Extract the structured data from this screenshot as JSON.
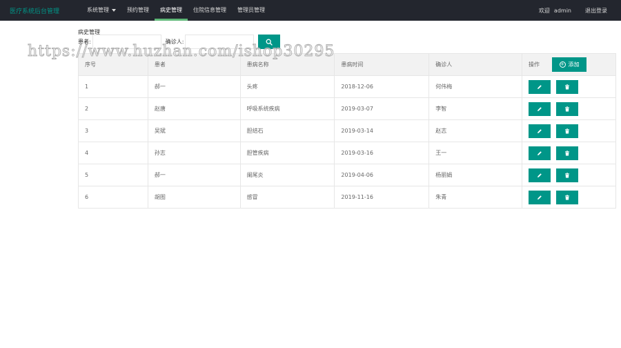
{
  "app": {
    "title": "医疗系统后台管理"
  },
  "nav": {
    "items": [
      {
        "label": "系统管理",
        "has_dropdown": true,
        "active": false
      },
      {
        "label": "预约管理",
        "active": false
      },
      {
        "label": "病史管理",
        "active": true
      },
      {
        "label": "住院信息管理",
        "active": false
      },
      {
        "label": "管理员管理",
        "active": false
      }
    ]
  },
  "user": {
    "welcome": "欢迎",
    "name": "admin",
    "logout": "退出登录"
  },
  "page": {
    "section_title": "病史管理"
  },
  "search": {
    "patient_label": "患者:",
    "patient_value": "",
    "doctor_label": "确诊人:",
    "doctor_value": ""
  },
  "watermark": "https://www.huzhan.com/ishop30295",
  "table": {
    "headers": [
      "序号",
      "患者",
      "患病名称",
      "患病时间",
      "确诊人",
      "操作"
    ],
    "add_label": "添加",
    "rows": [
      [
        "1",
        "郝一",
        "头疼",
        "2018-12-06",
        "何伟梅"
      ],
      [
        "2",
        "赵唐",
        "呼吸系统疾病",
        "2019-03-07",
        "李智"
      ],
      [
        "3",
        "吴斌",
        "胆结石",
        "2019-03-14",
        "赵志"
      ],
      [
        "4",
        "孙志",
        "胆管疾病",
        "2019-03-16",
        "王一"
      ],
      [
        "5",
        "郝一",
        "阑尾炎",
        "2019-04-06",
        "杨丽娟"
      ],
      [
        "6",
        "胡图",
        "感冒",
        "2019-11-16",
        "朱青"
      ]
    ]
  },
  "colors": {
    "accent": "#009688",
    "nav_bg": "#23262e",
    "nav_active_bar": "#5fb878",
    "logo": "#009688"
  },
  "icons": {
    "search": "search-icon",
    "edit": "pencil-icon",
    "delete": "trash-icon",
    "add": "plus-circle-icon",
    "dropdown": "caret-down-icon"
  }
}
